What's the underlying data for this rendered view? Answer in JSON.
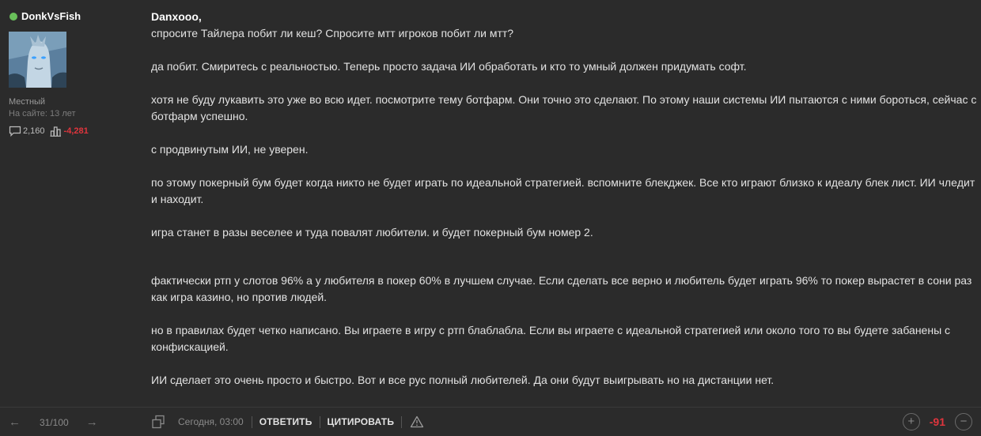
{
  "author": {
    "name": "DonkVsFish",
    "online_color": "#69c05a",
    "rank": "Местный",
    "on_site": "На сайте: 13 лет",
    "posts": "2,160",
    "reputation": "-4,281",
    "posts_icon": "comment-icon",
    "rep_icon": "chart-bars-icon"
  },
  "message": {
    "quote_author": "Danxooo,",
    "paragraphs": [
      "спросите Тайлера побит ли кеш? Спросите мтт игроков побит ли мтт?",
      "да побит. Смиритесь с реальностью. Теперь просто задача ИИ обработать и кто то умный должен придумать софт.",
      "хотя не буду лукавить это уже во всю идет. посмотрите тему ботфарм. Они точно это сделают. По этому наши системы ИИ пытаются с ними бороться, сейчас с ботфарм успешно.",
      "с продвинутым ИИ, не уверен.",
      "по этому покерный бум будет когда никто не будет играть по идеальной стратегией. вспомните блекджек. Все кто играют близко к идеалу блек лист. ИИ члeдит и находит.",
      "игра станет в разы веселее и туда повалят любители. и будет покерный бум номер 2.",
      "фактически ртп у слотов 96% а у любителя в покер 60% в лучшем случае. Если сделать все верно и любитель будет играть 96% то покер вырастет в сони раз как игра казино, но против людей.",
      "но в правилах будет четко написано. Вы играете в игру с ртп блаблабла. Если вы играете с идеальной стратегией или около того то вы будете забанены с конфискацией.",
      "ИИ сделает это очень просто и быстро. Вот и все рус полный любителей. Да они будут выигрывать но на дистанции нет."
    ]
  },
  "footer": {
    "pager": {
      "prev_icon": "arrow-left-icon",
      "position": "31/100",
      "next_icon": "arrow-right-icon"
    },
    "copy_icon": "copy-link-icon",
    "timestamp": "Сегодня, 03:00",
    "reply_label": "ОТВЕТИТЬ",
    "quote_label": "ЦИТИРОВАТЬ",
    "report_icon": "warning-icon",
    "vote": {
      "plus": "+",
      "score": "-91",
      "minus": "−",
      "score_color": "#e0353d"
    }
  }
}
